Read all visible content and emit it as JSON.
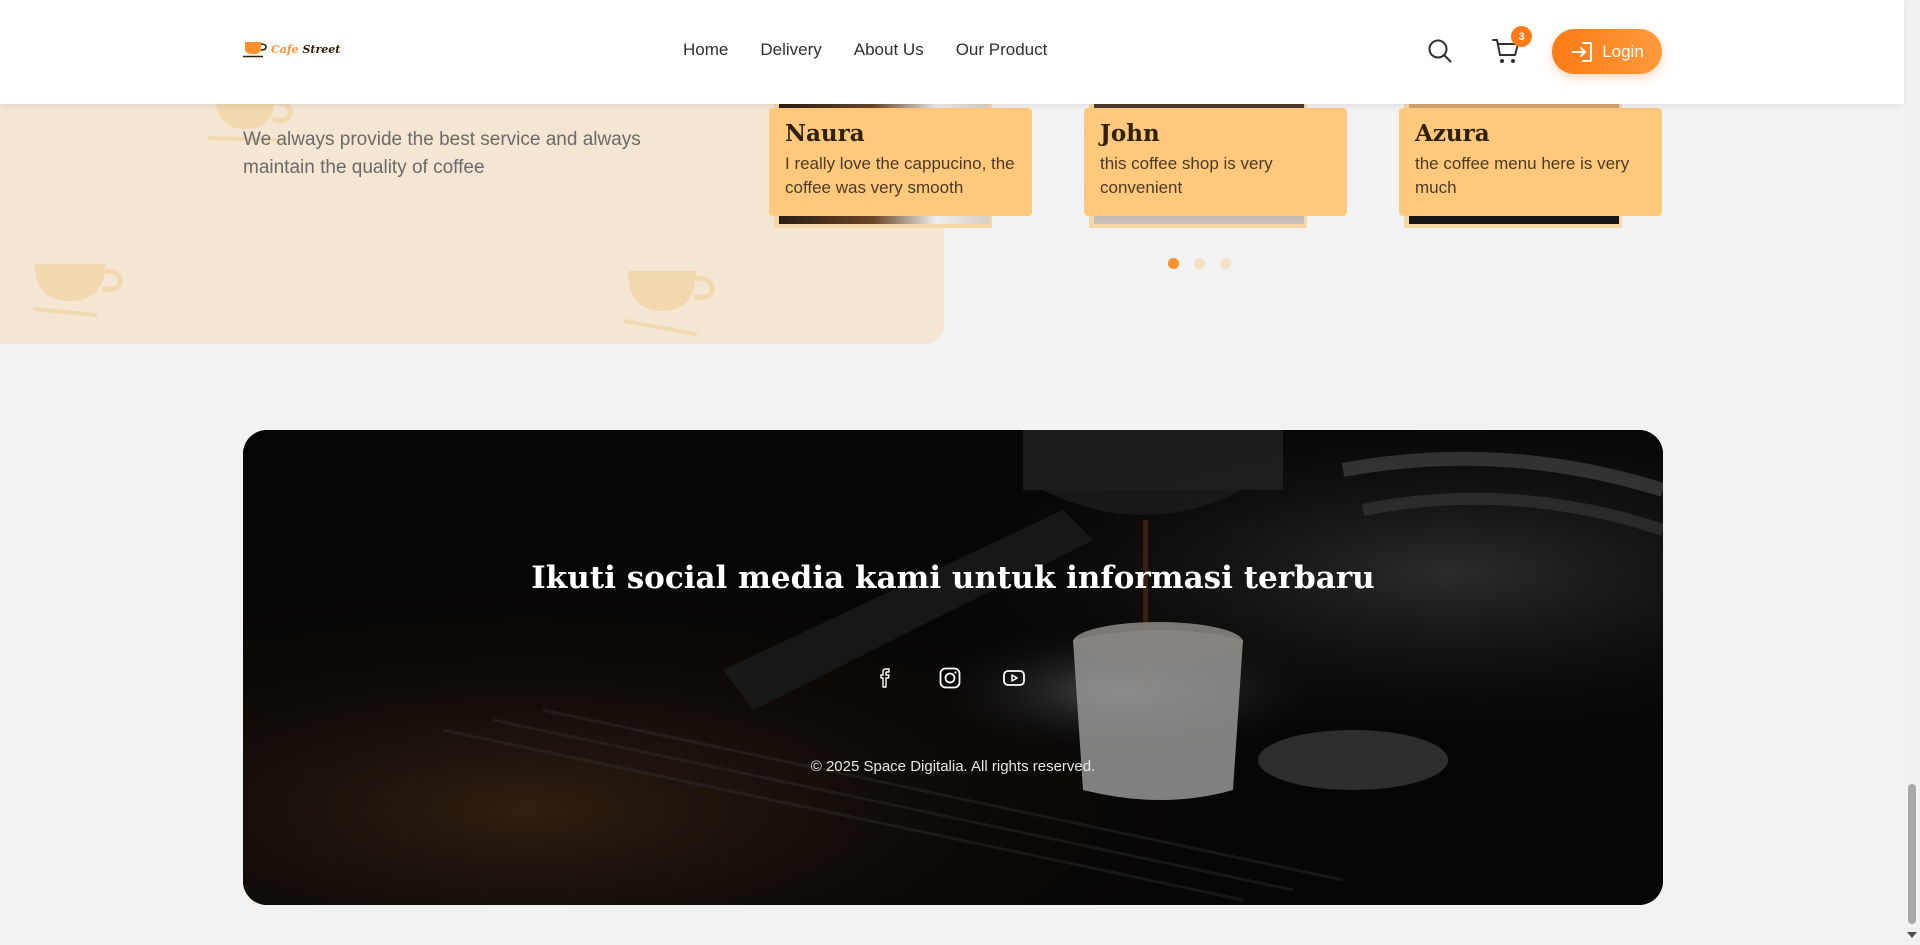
{
  "brand": {
    "logo_text_1": "Cafe",
    "logo_text_2": "Street",
    "accent": "#ff902a"
  },
  "nav": {
    "items": [
      "Home",
      "Delivery",
      "About Us",
      "Our Product"
    ]
  },
  "header": {
    "cart_count": "3",
    "login_label": "Login",
    "search_icon": "search-icon",
    "cart_icon": "cart-icon"
  },
  "testimonials": {
    "subtitle": "We always provide the best service and always maintain the quality of coffee",
    "cards": [
      {
        "name": "Naura",
        "text": "I really love the cappucino, the coffee was very smooth"
      },
      {
        "name": "John",
        "text": "this coffee shop is very convenient"
      },
      {
        "name": "Azura",
        "text": "the coffee menu here is very much"
      }
    ],
    "active_dot": 0,
    "dot_count": 3
  },
  "social": {
    "title": "Ikuti social media kami untuk informasi terbaru",
    "icons": [
      "facebook-icon",
      "instagram-icon",
      "youtube-icon"
    ],
    "copyright": "© 2025 Space Digitalia. All rights reserved."
  }
}
